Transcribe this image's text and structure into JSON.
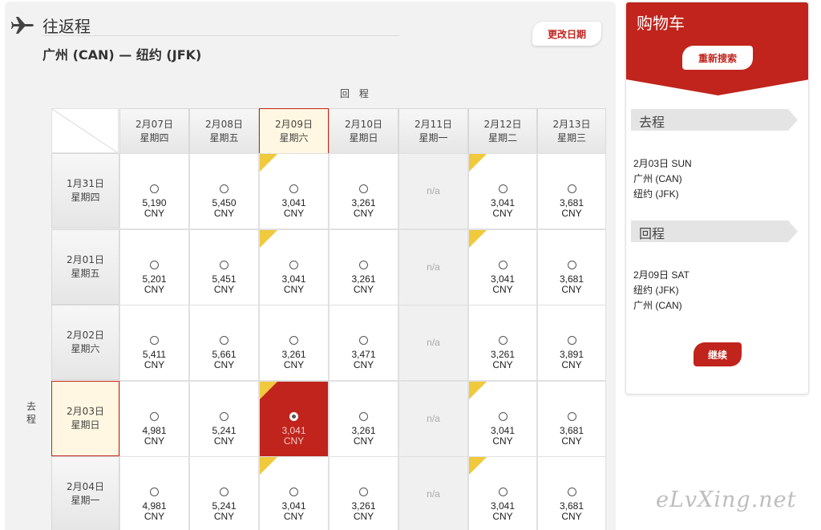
{
  "header": {
    "icon": "airplane-icon",
    "title": "往返程",
    "route": "广州 (CAN) — 纽约 (JFK)",
    "change_date_label": "更改日期"
  },
  "grid": {
    "return_label": "回 程",
    "depart_label": "去程",
    "columns": [
      {
        "date": "2月07日",
        "weekday": "星期四"
      },
      {
        "date": "2月08日",
        "weekday": "星期五"
      },
      {
        "date": "2月09日",
        "weekday": "星期六"
      },
      {
        "date": "2月10日",
        "weekday": "星期日"
      },
      {
        "date": "2月11日",
        "weekday": "星期一"
      },
      {
        "date": "2月12日",
        "weekday": "星期二"
      },
      {
        "date": "2月13日",
        "weekday": "星期三"
      }
    ],
    "selected_column": 2,
    "selected_row": 3,
    "currency": "CNY",
    "na_label": "n/a",
    "flag_color": "#f0c93c",
    "rows": [
      {
        "date": "1月31日",
        "weekday": "星期四",
        "prices": [
          "5,190",
          "5,450",
          "3,041",
          "3,261",
          null,
          "3,041",
          "3,681"
        ],
        "flags": [
          false,
          false,
          true,
          false,
          false,
          true,
          false
        ]
      },
      {
        "date": "2月01日",
        "weekday": "星期五",
        "prices": [
          "5,201",
          "5,451",
          "3,041",
          "3,261",
          null,
          "3,041",
          "3,681"
        ],
        "flags": [
          false,
          false,
          true,
          false,
          false,
          true,
          false
        ]
      },
      {
        "date": "2月02日",
        "weekday": "星期六",
        "prices": [
          "5,411",
          "5,661",
          "3,261",
          "3,471",
          null,
          "3,261",
          "3,891"
        ],
        "flags": [
          false,
          false,
          false,
          false,
          false,
          false,
          false
        ]
      },
      {
        "date": "2月03日",
        "weekday": "星期日",
        "prices": [
          "4,981",
          "5,241",
          "3,041",
          "3,261",
          null,
          "3,041",
          "3,681"
        ],
        "flags": [
          false,
          false,
          true,
          false,
          false,
          true,
          false
        ]
      },
      {
        "date": "2月04日",
        "weekday": "星期一",
        "prices": [
          "4,981",
          "5,241",
          "3,041",
          "3,261",
          null,
          "3,041",
          "3,681"
        ],
        "flags": [
          false,
          false,
          true,
          false,
          false,
          true,
          false
        ]
      }
    ]
  },
  "cart": {
    "title": "购物车",
    "research_label": "重新搜索",
    "outbound": {
      "label": "去程",
      "date": "2月03日 SUN",
      "from": "广州 (CAN)",
      "to": "纽约 (JFK)"
    },
    "inbound": {
      "label": "回程",
      "date": "2月09日 SAT",
      "from": "纽约 (JFK)",
      "to": "广州 (CAN)"
    },
    "continue_label": "继续"
  },
  "colors": {
    "accent": "#c0241c",
    "selected_header_bg": "#fff7e1"
  },
  "watermark": "eLvXing.net"
}
